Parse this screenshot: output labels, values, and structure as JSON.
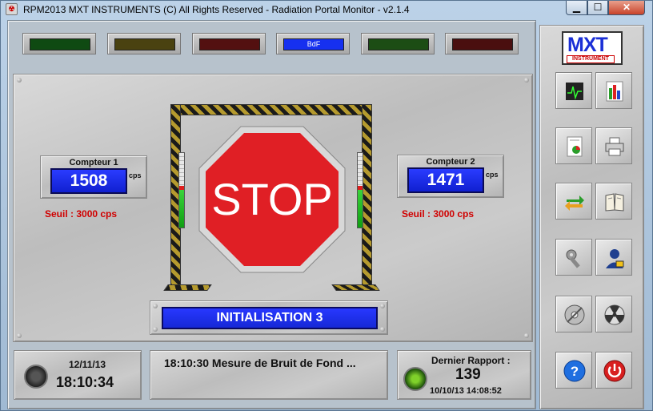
{
  "window": {
    "title": "RPM2013 MXT INSTRUMENTS (C) All Rights Reserved - Radiation Portal Monitor - v2.1.4",
    "min_label": "▁",
    "max_label": "☐",
    "close_label": "✕"
  },
  "leds": [
    {
      "label": "",
      "color": "#0f4a12"
    },
    {
      "label": "",
      "color": "#4a4210"
    },
    {
      "label": "",
      "color": "#531010"
    },
    {
      "label": "BdF",
      "color": "#1630f0"
    },
    {
      "label": "",
      "color": "#1c4d14"
    },
    {
      "label": "",
      "color": "#4a0f0f"
    }
  ],
  "counter1": {
    "title": "Compteur 1",
    "value": "1508",
    "unit": "cps",
    "threshold": "Seuil : 3000  cps"
  },
  "counter2": {
    "title": "Compteur 2",
    "value": "1471",
    "unit": "cps",
    "threshold": "Seuil : 3000  cps"
  },
  "portal": {
    "stop_text": "STOP",
    "left_level": 0.5,
    "right_level": 0.5,
    "hazard_colors": [
      "#1a1a1a",
      "#b59a2e"
    ],
    "stop_color": "#e01f25"
  },
  "status": {
    "text": "INITIALISATION 3"
  },
  "clock": {
    "date": "12/11/13",
    "time": "18:10:34",
    "icon": "status-dial-icon"
  },
  "message": {
    "text": "18:10:30  Mesure de Bruit de Fond ..."
  },
  "report": {
    "title": "Dernier Rapport :",
    "count": "139",
    "datetime": "10/10/13  14:08:52",
    "icon": "radiation-icon"
  },
  "logo": {
    "line1": "MXT",
    "line2": "INSTRUMENT"
  },
  "toolbar": [
    {
      "name": "monitor-icon"
    },
    {
      "name": "bar-chart-icon"
    },
    {
      "name": "pie-report-icon"
    },
    {
      "name": "printer-icon"
    },
    {
      "name": "sync-arrows-icon"
    },
    {
      "name": "book-icon"
    },
    {
      "name": "settings-tools-icon"
    },
    {
      "name": "operator-user-icon"
    },
    {
      "name": "disc-no-icon"
    },
    {
      "name": "radiation-source-icon"
    },
    {
      "name": "help-icon"
    },
    {
      "name": "power-icon"
    }
  ]
}
